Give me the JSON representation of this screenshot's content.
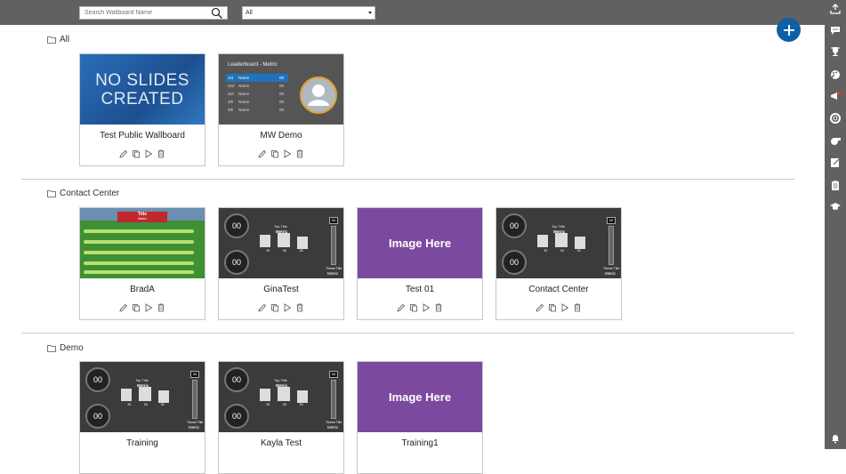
{
  "search": {
    "placeholder": "Search Wallboard Name"
  },
  "filter": {
    "selected": "All"
  },
  "sections": [
    {
      "name": "All",
      "cards": [
        {
          "title": "Test Public Wallboard",
          "thumb": "NO SLIDES CREATED"
        },
        {
          "title": "MW Demo",
          "thumb_title": "Leaderboard - Metric"
        }
      ]
    },
    {
      "name": "Contact Center",
      "cards": [
        {
          "title": "BradA"
        },
        {
          "title": "GinaTest"
        },
        {
          "title": "Test 01",
          "thumb": "Image Here"
        },
        {
          "title": "Contact Center"
        }
      ]
    },
    {
      "name": "Demo",
      "cards": [
        {
          "title": "Training"
        },
        {
          "title": "Kayla Test"
        },
        {
          "title": "Training1",
          "thumb": "Image Here"
        }
      ]
    }
  ],
  "leaderboard": {
    "rows": [
      {
        "rank": "1st",
        "name": "Name",
        "value": "00"
      },
      {
        "rank": "2nd",
        "name": "Name",
        "value": "00"
      },
      {
        "rank": "3rd",
        "name": "Name",
        "value": "00"
      },
      {
        "rank": "4th",
        "name": "Name",
        "value": "00"
      },
      {
        "rank": "5th",
        "name": "Name",
        "value": "00"
      }
    ]
  },
  "gauge": {
    "value": "00",
    "top_title": "Top Title",
    "metric": "Metric",
    "bar_value": "00",
    "theme_title": "Theme Title",
    "metric_label": "Metric",
    "small_values": [
      "30",
      "00",
      "00"
    ]
  },
  "race": {
    "title": "Title",
    "subtitle": "Metric"
  },
  "colors": {
    "topbar": "#616161",
    "fab": "#0d5fa6",
    "purple": "#7b4a9e",
    "notification": "#e53935"
  }
}
